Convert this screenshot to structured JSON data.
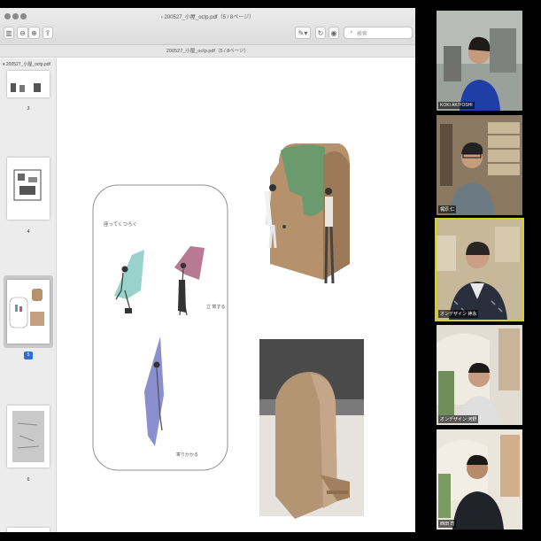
{
  "viewer": {
    "window_title": "‹ 200527_小屋_octp.pdf（5 / 8ページ）",
    "document_bar": "200527_小屋_octp.pdf（5 / 8ページ）",
    "search_placeholder": "検索",
    "sidebar_header": "▾ 200527_小屋_octp.pdf",
    "current_page": "5",
    "thumbnails": [
      {
        "page": "3"
      },
      {
        "page": "4"
      },
      {
        "page": "5",
        "selected": true
      },
      {
        "page": "6"
      }
    ]
  },
  "page": {
    "diagram_heading": "座ってくつろぐ",
    "label_stand": "立 寄する",
    "label_lean": "寄りかかる"
  },
  "participants": [
    {
      "name": "KOKI AKIYOSHI",
      "active": false
    },
    {
      "name": "梶原 仁",
      "active": false
    },
    {
      "name": "オンデザイン 神永",
      "active": true
    },
    {
      "name": "オンデザイン 河野",
      "active": false
    },
    {
      "name": "西田 司",
      "active": false
    }
  ],
  "colors": {
    "active_speaker_border": "#d4d21a",
    "selection_blue": "#2a6fd6",
    "model_wood": "#b5916c",
    "model_green": "#6a9a6e"
  }
}
